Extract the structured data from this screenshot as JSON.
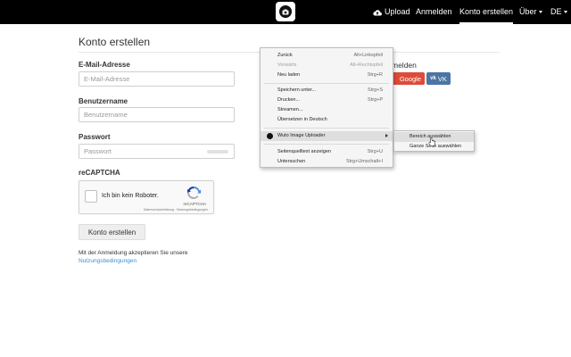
{
  "navbar": {
    "upload_label": "Upload",
    "login_label": "Anmelden",
    "create_label": "Konto erstellen",
    "about_label": "Über",
    "lang_label": "DE"
  },
  "form": {
    "title": "Konto erstellen",
    "email_label": "E-Mail-Adresse",
    "email_placeholder": "E-Mail-Adresse",
    "username_label": "Benutzername",
    "username_placeholder": "Benutzername",
    "password_label": "Passwort",
    "password_placeholder": "Passwort",
    "recaptcha_label": "reCAPTCHA",
    "recaptcha_checkbox_text": "Ich bin kein Roboter.",
    "recaptcha_brand": "reCAPTCHA",
    "recaptcha_links": "Datenschutzerklärung - Nutzungsbedingungen",
    "submit_label": "Konto erstellen",
    "terms_text": "Mit der Anmeldung akzeptieren Sie unsere",
    "terms_link": "Nutzungsbedingungen"
  },
  "social": {
    "heading": "melden",
    "google_label": "Google",
    "vk_icon": "vk",
    "vk_label": "VK"
  },
  "context_menu": {
    "items": [
      {
        "label": "Zurück",
        "shortcut": "Alt+Linkspfeil"
      },
      {
        "label": "Vorwärts",
        "shortcut": "Alt+Rechtspfeil"
      },
      {
        "label": "Neu laden",
        "shortcut": "Strg+R"
      },
      {
        "label": "Speichern unter...",
        "shortcut": "Strg+S"
      },
      {
        "label": "Drucken...",
        "shortcut": "Strg+P"
      },
      {
        "label": "Streamen...",
        "shortcut": ""
      },
      {
        "label": "Übersetzen in Deutsch",
        "shortcut": ""
      },
      {
        "label": "Wuto Image Uploader",
        "shortcut": ""
      },
      {
        "label": "Seitenquelltext anzeigen",
        "shortcut": "Strg+U"
      },
      {
        "label": "Untersuchen",
        "shortcut": "Strg+Umschalt+I"
      }
    ],
    "submenu": [
      {
        "label": "Bereich auswählen"
      },
      {
        "label": "Ganze Seite auswählen"
      }
    ]
  },
  "colors": {
    "navbar_bg": "#000000",
    "link": "#3a8fd1",
    "google": "#dd4b39",
    "vk": "#4c75a3"
  },
  "icons": {
    "logo": "camera-icon",
    "upload": "cloud-upload-icon",
    "submenu_arrow": "chevron-right-icon",
    "cursor": "mouse-pointer-icon"
  }
}
